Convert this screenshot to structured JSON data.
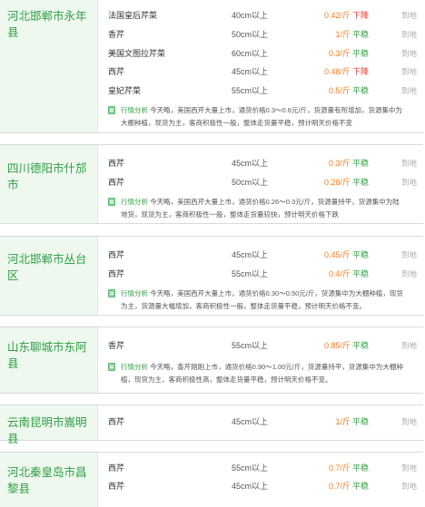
{
  "blocks": [
    {
      "location": "河北邯郸市永年县",
      "rows": [
        {
          "name": "法国皇后芹菜",
          "size": "40cm以上",
          "price": "0.42/斤",
          "trend": "下降"
        },
        {
          "name": "香芹",
          "size": "50cm以上",
          "price": "1/斤",
          "trend": "平稳"
        },
        {
          "name": "美国文图拉芹菜",
          "size": "60cm以上",
          "price": "0.3/斤",
          "trend": "平稳"
        },
        {
          "name": "西芹",
          "size": "45cm以上",
          "price": "0.48/斤",
          "trend": "下降"
        },
        {
          "name": "皇妃芹菜",
          "size": "55cm以上",
          "price": "0.5/斤",
          "trend": "平稳"
        }
      ],
      "note_label": "行情分析",
      "note": "今天略，美国西芹大量上市，通货价格0.3～0.6元/斤，货源量有所增加，货源集中为大棚种植，现货为主，客商积极性一般，整体走货量平稳，预计明天价格不变"
    },
    {
      "location": "四川德阳市什邡市",
      "rows": [
        {
          "name": "西芹",
          "size": "45cm以上",
          "price": "0.3/斤",
          "trend": "平稳"
        },
        {
          "name": "西芹",
          "size": "50cm以上",
          "price": "0.28/斤",
          "trend": "平稳"
        }
      ],
      "note_label": "行情分析",
      "note": "今天略，美国西芹大量上市，通货价格0.26～0.3元/斤，货源量持平，货源集中为陆地货，现货为主，客商积极性一般，整体走货量较快，预计明天价格下跌"
    },
    {
      "location": "河北邯郸市丛台区",
      "rows": [
        {
          "name": "西芹",
          "size": "45cm以上",
          "price": "0.45/斤",
          "trend": "平稳"
        },
        {
          "name": "西芹",
          "size": "55cm以上",
          "price": "0.4/斤",
          "trend": "平稳"
        }
      ],
      "note_label": "行情分析",
      "note": "今天略，美国西芹大量上市，通货价格0.30～0.50元/斤，货源集中为大棚种植，现货为主，货源量大幅增加，客商积极性一般，整体走货量平稳，预计明天价格不变。"
    },
    {
      "location": "山东聊城市东阿县",
      "rows": [
        {
          "name": "香芹",
          "size": "55cm以上",
          "price": "0.85/斤",
          "trend": "平稳"
        }
      ],
      "note_label": "行情分析",
      "note": "今天略，香芹刚刚上市，通货价格0.90～1.00元/斤，货源量持平，货源集中为大棚种植，现货为主，客商积极性高，整体走货量平稳，预计明天价格不变。"
    },
    {
      "location": "云南昆明市嵩明县",
      "rows": [
        {
          "name": "西芹",
          "size": "45cm以上",
          "price": "1/斤",
          "trend": "平稳"
        }
      ]
    },
    {
      "location": "河北秦皇岛市昌黎县",
      "rows": [
        {
          "name": "西芹",
          "size": "55cm以上",
          "price": "0.7/斤",
          "trend": "平稳"
        },
        {
          "name": "西芹",
          "size": "45cm以上",
          "price": "0.7/斤",
          "trend": "平稳"
        }
      ]
    }
  ],
  "tag_text": "到地",
  "colors": {
    "location_green": "#2e9e43",
    "price_orange": "#ff7a1a",
    "trend_down_red": "#e8382a",
    "location_bg": "#eef8ef"
  },
  "icons": {
    "note": "note-icon"
  }
}
